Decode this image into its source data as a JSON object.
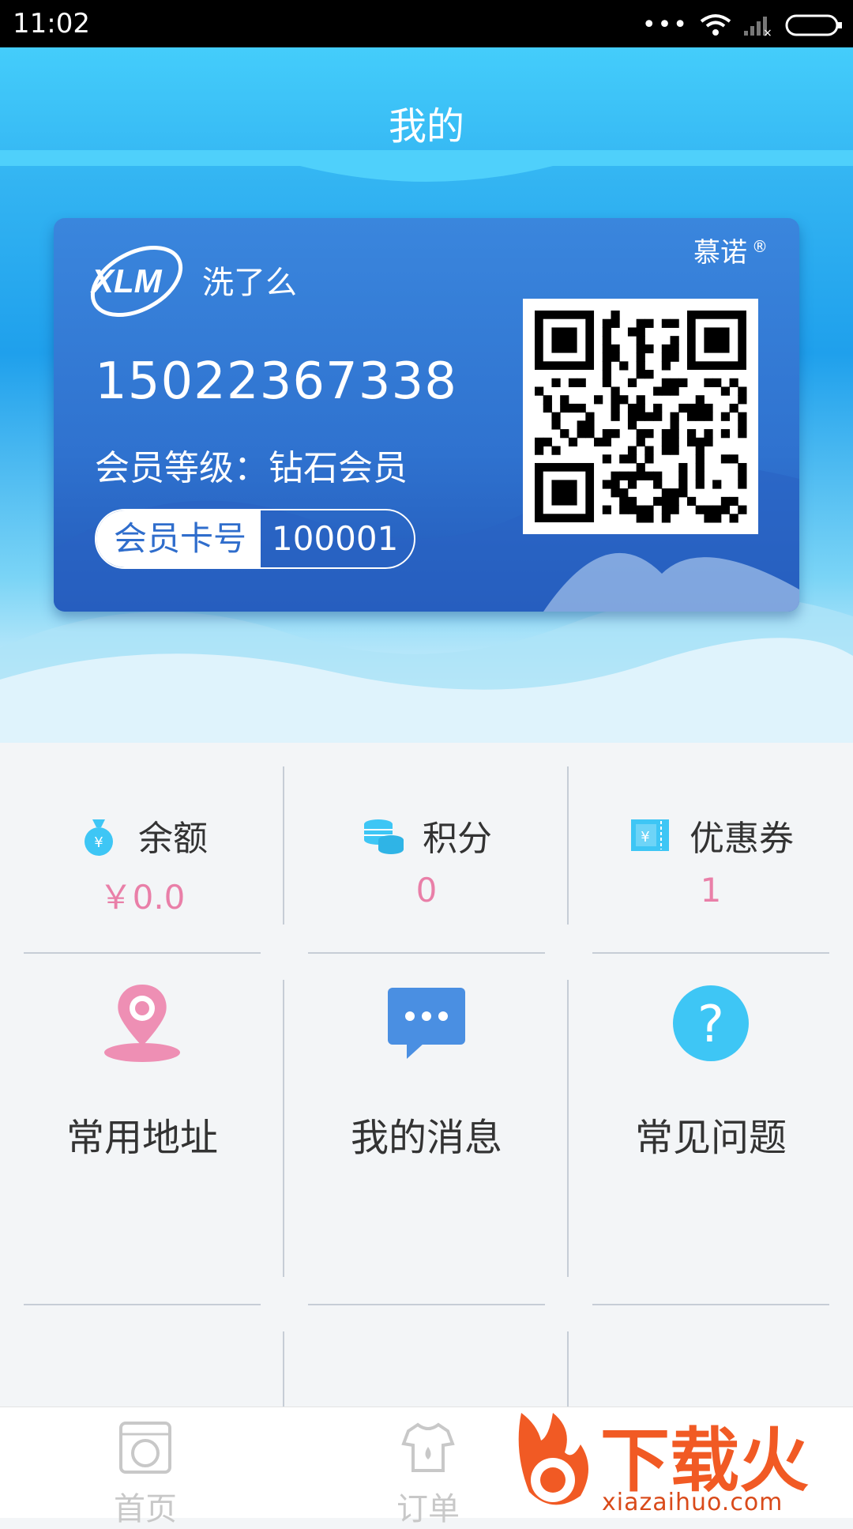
{
  "status_bar": {
    "time": "11:02"
  },
  "header": {
    "title": "我的"
  },
  "card": {
    "brand_logo": "XLM",
    "brand_name": "洗了么",
    "trademark": "慕诺",
    "trademark_symbol": "®",
    "phone": "15022367338",
    "member_level": "会员等级：钻石会员",
    "card_no_label": "会员卡号",
    "card_no": "100001"
  },
  "stats": [
    {
      "label": "余额",
      "value": "￥0.0",
      "icon": "money-bag-icon"
    },
    {
      "label": "积分",
      "value": "0",
      "icon": "coins-icon"
    },
    {
      "label": "优惠券",
      "value": "1",
      "icon": "coupon-icon"
    }
  ],
  "features": [
    {
      "label": "常用地址",
      "icon": "location-pin-icon"
    },
    {
      "label": "我的消息",
      "icon": "message-bubble-icon"
    },
    {
      "label": "常见问题",
      "icon": "question-icon"
    }
  ],
  "tabs": [
    {
      "label": "首页",
      "icon": "washing-machine-icon"
    },
    {
      "label": "订单",
      "icon": "shirt-icon"
    }
  ],
  "watermark": {
    "text": "下载火",
    "url_text": "xiazaihuo.com"
  },
  "colors": {
    "accent": "#33b4f2",
    "value_pink": "#e97fa8",
    "card_blue": "#2f72cf",
    "question_blue": "#3ec6f5"
  }
}
